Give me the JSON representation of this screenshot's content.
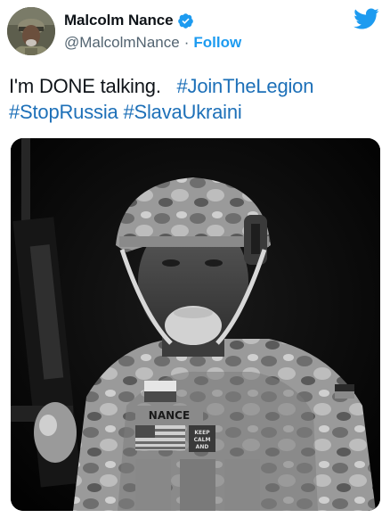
{
  "user": {
    "display_name": "Malcolm Nance",
    "handle": "@MalcolmNance",
    "separator": "·",
    "follow_label": "Follow",
    "verified": true
  },
  "tweet": {
    "text_plain": "I'm DONE talking.",
    "hashtags": [
      "#JoinTheLegion",
      "#StopRussia",
      "#SlavaUkraini"
    ]
  },
  "media": {
    "name_tape": "NANCE",
    "patch_line1": "KEEP",
    "patch_line2": "CALM",
    "patch_line3": "AND"
  },
  "colors": {
    "twitter_blue": "#1d9bf0",
    "hashtag_blue": "#1d70b8",
    "handle_gray": "#536471",
    "text": "#0f1419"
  },
  "icons": {
    "brand": "twitter-bird-icon",
    "badge": "verified-badge-icon"
  }
}
